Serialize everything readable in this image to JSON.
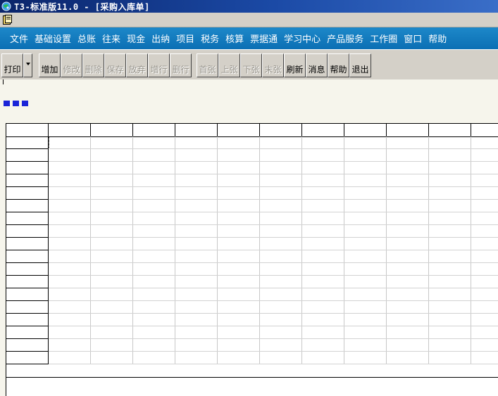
{
  "window": {
    "title": "T3-标准版11.0 - [采购入库单]",
    "title_color": "#ffffff",
    "title_bar_color": "#0a246a"
  },
  "menu": {
    "items": [
      "文件",
      "基础设置",
      "总账",
      "往来",
      "现金",
      "出纳",
      "项目",
      "税务",
      "核算",
      "票据通",
      "学习中心",
      "产品服务",
      "工作圈",
      "窗口",
      "帮助"
    ],
    "bar_color": "#0b6fb4"
  },
  "toolbar": {
    "print": "打印",
    "add": "增加",
    "edit": "修改",
    "delete": "删除",
    "save": "保存",
    "abandon": "放弃",
    "add_row": "增行",
    "delete_row": "删行",
    "first": "首张",
    "prev": "上张",
    "next": "下张",
    "last": "末张",
    "refresh": "刷新",
    "message": "消息",
    "help": "帮助",
    "exit": "退出"
  },
  "icons": {
    "app": "app-globe-icon",
    "document": "document-folder-icon",
    "progress_square_color": "#1a24d8"
  },
  "grid": {
    "rows": 18,
    "columns": 11
  }
}
